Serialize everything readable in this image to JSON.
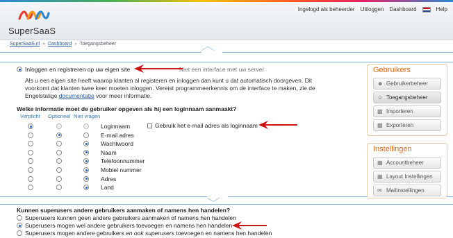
{
  "header": {
    "logo_text": "SuperSaaS",
    "nav": {
      "login_admin": "Ingelogd als beheerder",
      "logout": "Uitloggen",
      "dashboard": "Dashboard",
      "help": "Help"
    }
  },
  "breadcrumb": {
    "root": "SuperSaaS.nl",
    "sep1": "»",
    "dashboard": "Dashboard",
    "sep2": "»",
    "current": "Toegangsbeheer"
  },
  "access": {
    "option_own_site": "Inloggen en registreren op uw eigen site",
    "option_interface_partial": "Niet een interface met uw server",
    "explanation_part1": "Als u een eigen site heeft waarop klanten al registeren en inloggen dan kunt u dat automatisch doorgeven. Dit voorkomt dat klanten twee keer moeten inloggen. Vereist programmeerkennis om de interface te maken, zie de Engelstalige ",
    "explanation_link": "documentatie",
    "explanation_part2": " voor meer informatie."
  },
  "fields": {
    "question": "Welke informatie moet de gebruiker opgeven als hij een loginnaam aanmaakt?",
    "col_required": "Verplicht",
    "col_optional": "Optioneel",
    "col_not_asked": "Niet vragen",
    "rows": [
      {
        "label": "Loginnaam",
        "selected": "required"
      },
      {
        "label": "E-mail adres",
        "selected": "optional"
      },
      {
        "label": "Wachtwoord",
        "selected": "not_asked"
      },
      {
        "label": "Naam",
        "selected": "not_asked"
      },
      {
        "label": "Telefoonnummer",
        "selected": "not_asked"
      },
      {
        "label": "Mobiel nummer",
        "selected": "not_asked"
      },
      {
        "label": "Adres",
        "selected": "not_asked"
      },
      {
        "label": "Land",
        "selected": "not_asked"
      }
    ],
    "email_as_login": "Gebruik het e-mail adres als loginnaam"
  },
  "sidebar": {
    "users_title": "Gebruikers",
    "users_items": [
      "Gebruikerbeheer",
      "Toegangsbeheer",
      "Importeren",
      "Exporteren"
    ],
    "settings_title": "Instellingen",
    "settings_items": [
      "Accountbeheer",
      "Layout Instellingen",
      "Mailinstellingen"
    ]
  },
  "superusers": {
    "question": "Kunnen superusers andere gebruikers aanmaken of namens hen handelen?",
    "options": [
      "Superusers kunnen geen andere gebruikers aanmaken of namens hen handelen",
      "Superusers mogen wel andere gebruikers toevoegen en namens hen handelen",
      "Superusers mogen andere gebruikers "
    ],
    "option3_em": "en ook superusers",
    "option3_rest": " toevoegen en namens hen handelen",
    "selected_index": 1
  },
  "colors": {
    "accent_orange": "#e06a1b",
    "link_blue": "#2b5c9c",
    "zoom_blue": "#7ab1e0",
    "arrow_red": "#cc1111"
  }
}
